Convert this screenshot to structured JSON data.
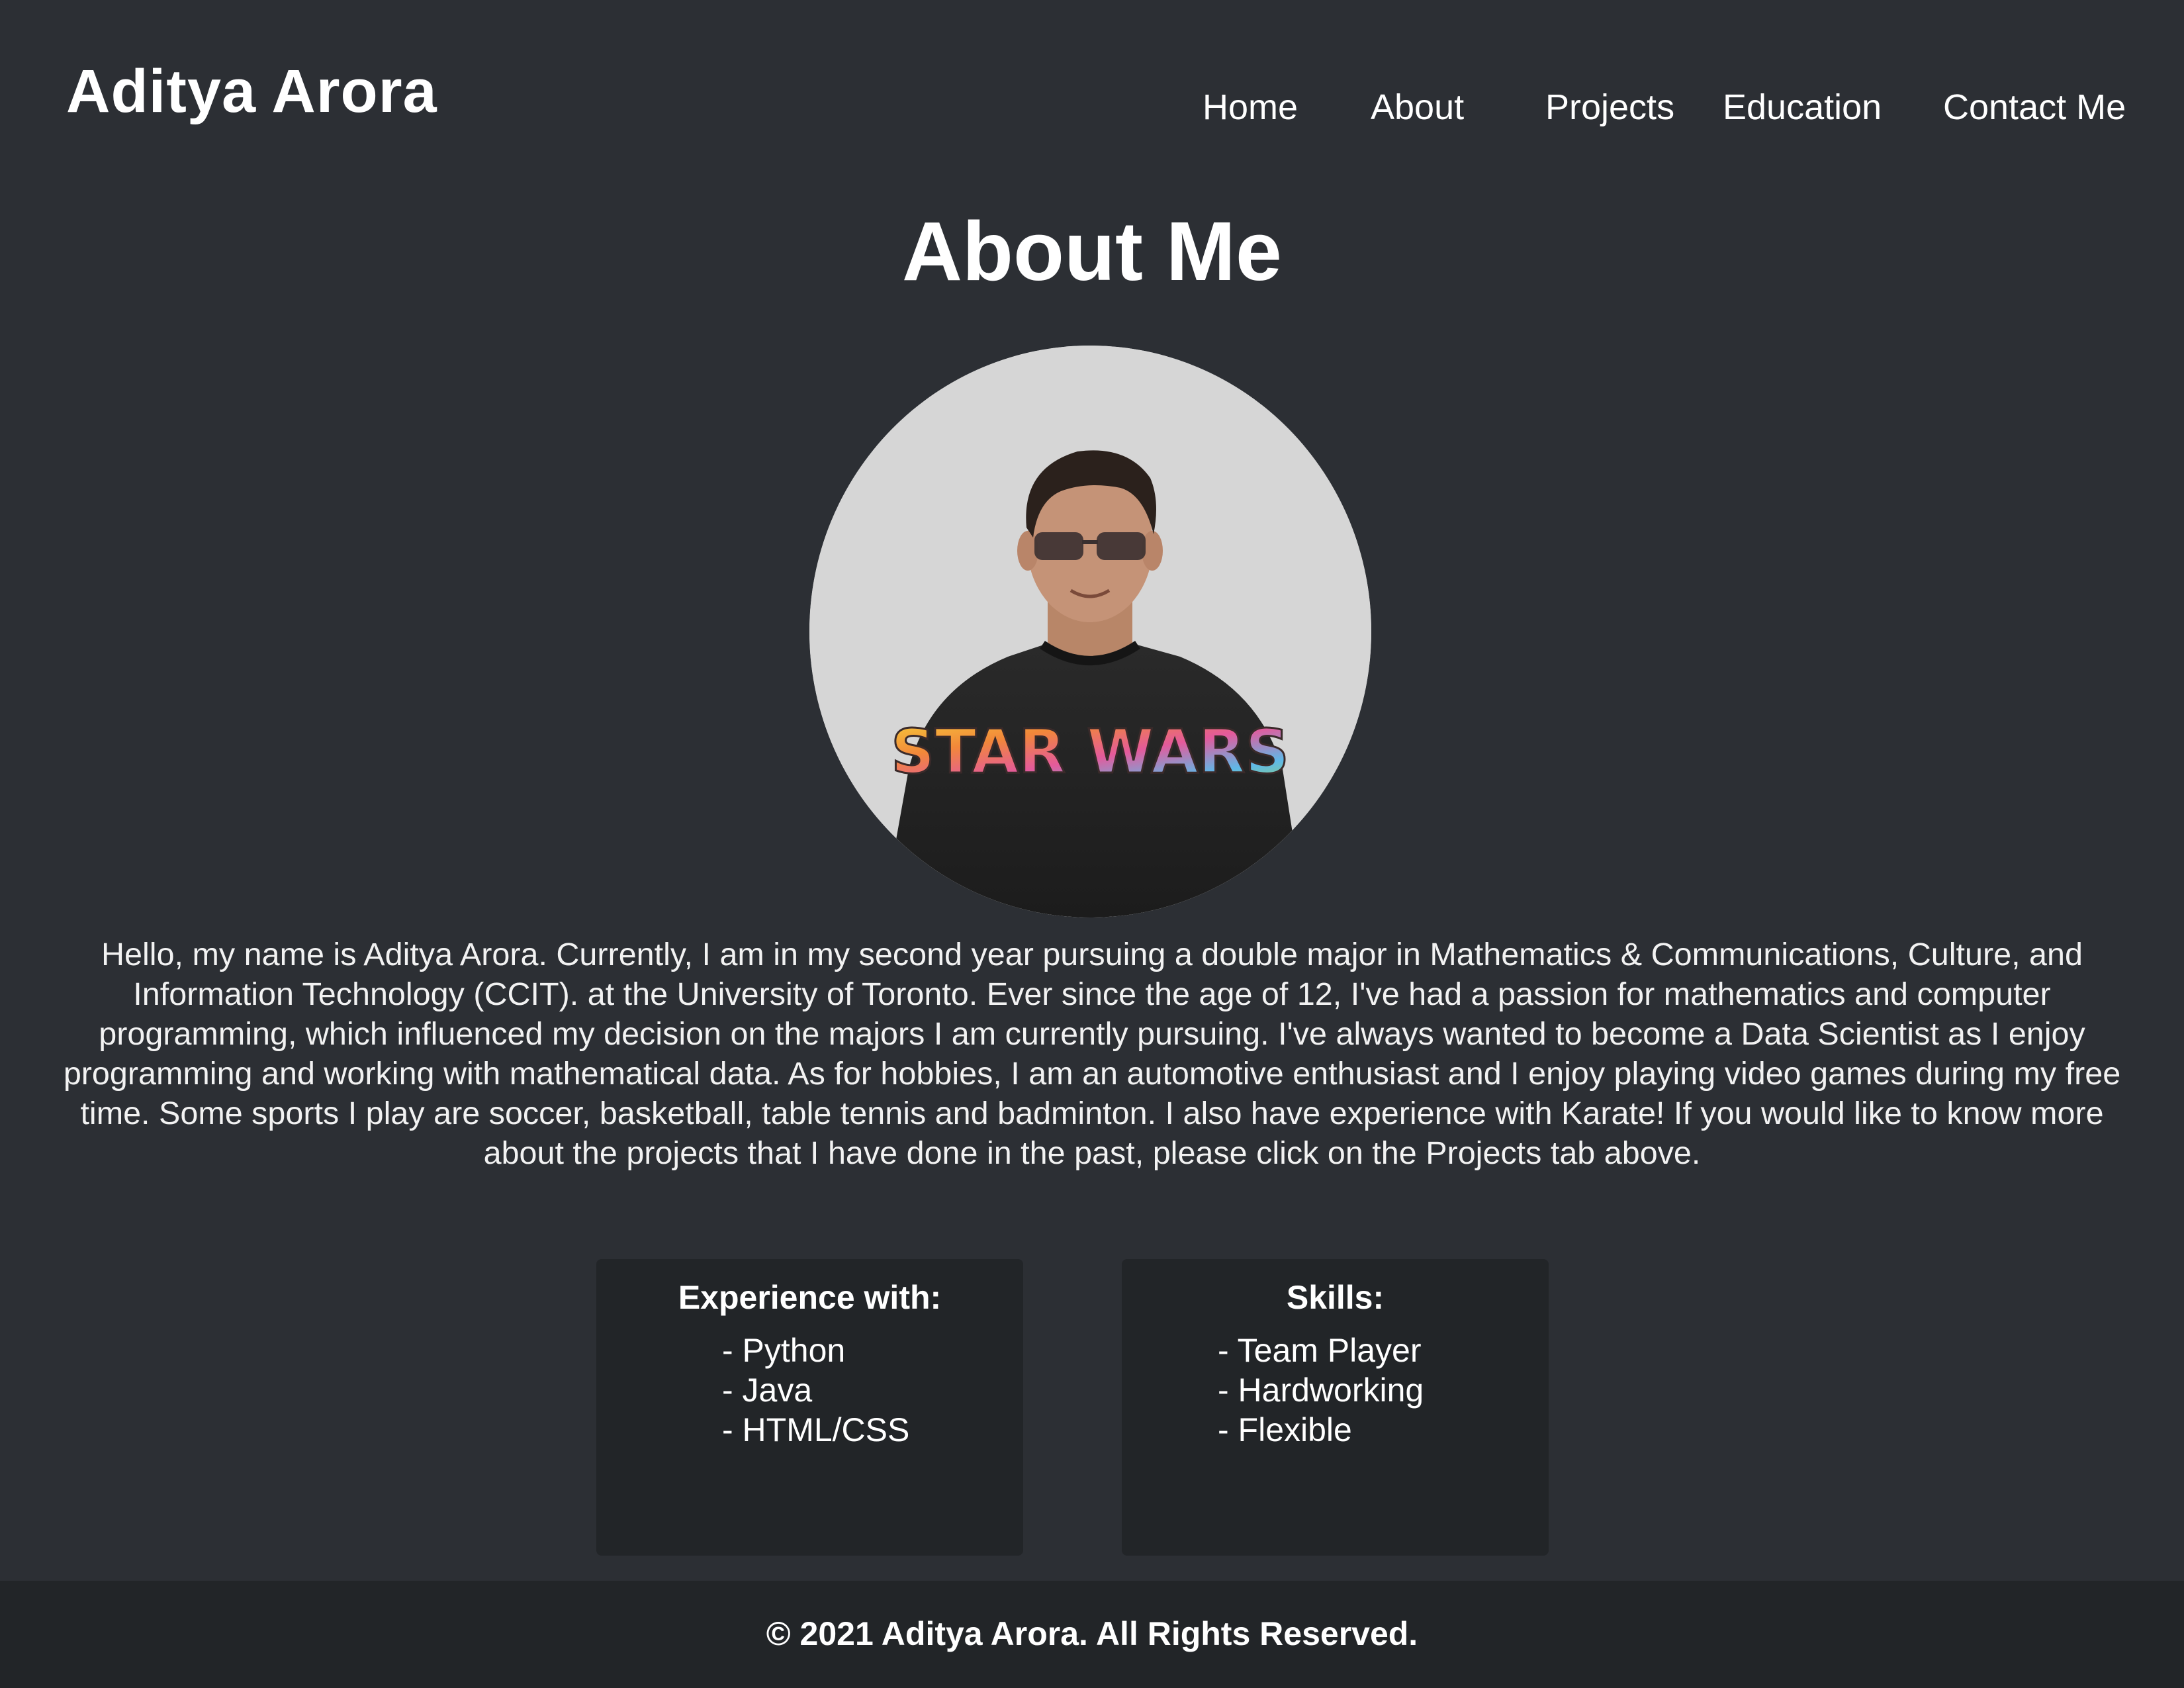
{
  "header": {
    "brand": "Aditya Arora",
    "nav": [
      {
        "label": "Home"
      },
      {
        "label": "About"
      },
      {
        "label": "Projects"
      },
      {
        "label": "Education"
      },
      {
        "label": "Contact Me"
      }
    ]
  },
  "about": {
    "title": "About Me",
    "photo_alt": "Aditya Arora",
    "photo_shirt_text": "STAR WARS",
    "bio": "Hello, my name is Aditya Arora. Currently, I am in my second year pursuing a double major in Mathematics & Communications, Culture, and Information Technology (CCIT). at the University of Toronto. Ever since the age of 12, I've had a passion for mathematics and computer programming, which influenced my decision on the majors I am currently pursuing. I've always wanted to become a Data Scientist as I enjoy programming and working with mathematical data. As for hobbies, I am an automotive enthusiast and I enjoy playing video games during my free time. Some sports I play are soccer, basketball, table tennis and badminton. I also have experience with Karate! If you would like to know more about the projects that I have done in the past, please click on the Projects tab above."
  },
  "experience": {
    "title": "Experience with:",
    "items": [
      "- Python",
      "- Java",
      "- HTML/CSS"
    ]
  },
  "skills": {
    "title": "Skills:",
    "items": [
      "- Team Player",
      "- Hardworking",
      "- Flexible"
    ]
  },
  "footer": {
    "text": "© 2021 Aditya Arora. All Rights Reserved."
  },
  "colors": {
    "background": "#2c2f34",
    "card_background": "#222528",
    "footer_background": "#222528",
    "text": "#ffffff"
  }
}
